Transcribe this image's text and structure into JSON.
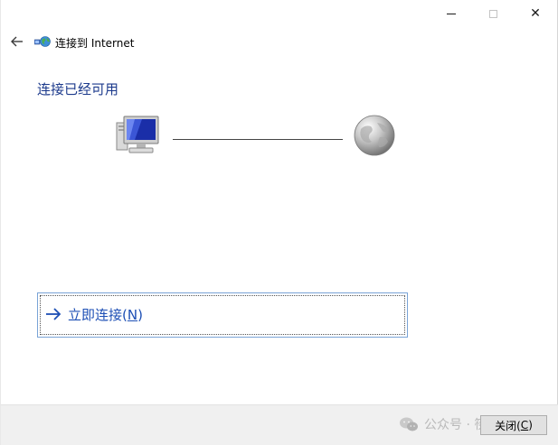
{
  "titlebar": {
    "minimize_icon": "minimize-icon",
    "maximize_icon": "maximize-icon",
    "close_glyph": "✕"
  },
  "nav": {
    "back_icon": "back-arrow-icon",
    "app_icon": "network-globe-icon",
    "title": "连接到 Internet"
  },
  "main": {
    "heading": "连接已经可用",
    "computer_icon": "computer-icon",
    "globe_icon": "internet-globe-icon",
    "connect_action": {
      "arrow_icon": "right-arrow-icon",
      "label": "立即连接(",
      "accelerator": "N",
      "label_end": ")"
    }
  },
  "footer": {
    "watermark": {
      "icon": "wechat-icon",
      "text": "公众号 · 筷子哥"
    },
    "close_button": {
      "label": "关闭(",
      "accelerator": "C",
      "label_end": ")"
    }
  },
  "colors": {
    "heading": "#1c3a8c",
    "link": "#1d4fb5",
    "focus_border": "#7aa3d6",
    "footer_bg": "#f0f0f0"
  }
}
